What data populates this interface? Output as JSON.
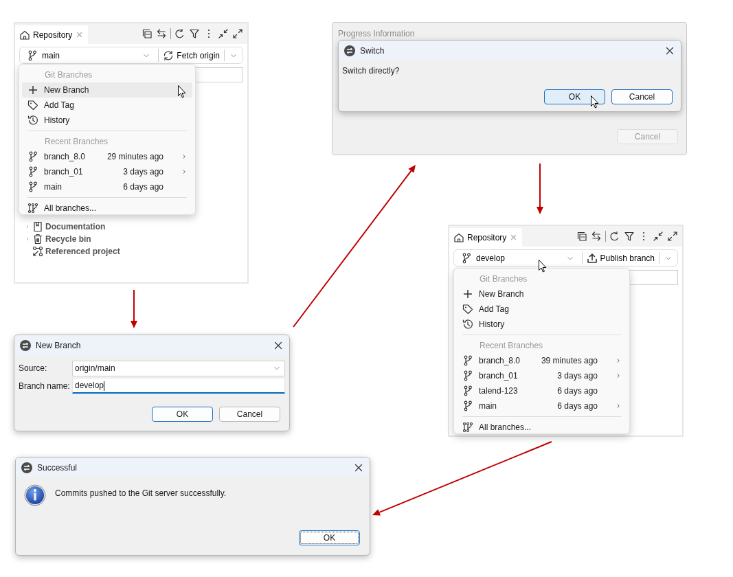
{
  "repository_panels": [
    {
      "tab": "Repository",
      "branch": "main",
      "action": {
        "kind": "fetch",
        "label": "Fetch origin"
      },
      "menu": {
        "heading": "Git Branches",
        "actions": [
          {
            "kind": "new",
            "label": "New Branch",
            "selected": true
          },
          {
            "kind": "tag",
            "label": "Add Tag",
            "selected": false
          },
          {
            "kind": "history",
            "label": "History",
            "selected": false
          }
        ],
        "recent_heading": "Recent Branches",
        "branches": [
          {
            "name": "branch_8.0",
            "time": "29 minutes ago",
            "submenu": true
          },
          {
            "name": "branch_01",
            "time": "3 days ago",
            "submenu": true
          },
          {
            "name": "main",
            "time": "6 days ago",
            "submenu": false
          }
        ],
        "all_label": "All branches..."
      },
      "tree": [
        {
          "kind": "documentation",
          "label": "Documentation",
          "expandable": true
        },
        {
          "kind": "recycle",
          "label": "Recycle bin",
          "expandable": true
        },
        {
          "kind": "referenced",
          "label": "Referenced project",
          "expandable": false
        }
      ]
    },
    {
      "tab": "Repository",
      "branch": "develop",
      "action": {
        "kind": "publish",
        "label": "Publish branch"
      },
      "menu": {
        "heading": "Git Branches",
        "actions": [
          {
            "kind": "new",
            "label": "New Branch",
            "selected": false
          },
          {
            "kind": "tag",
            "label": "Add Tag",
            "selected": false
          },
          {
            "kind": "history",
            "label": "History",
            "selected": false
          }
        ],
        "recent_heading": "Recent Branches",
        "branches": [
          {
            "name": "branch_8.0",
            "time": "39 minutes ago",
            "submenu": true
          },
          {
            "name": "branch_01",
            "time": "3 days ago",
            "submenu": true
          },
          {
            "name": "talend-123",
            "time": "6 days ago",
            "submenu": false
          },
          {
            "name": "main",
            "time": "6 days ago",
            "submenu": true
          }
        ],
        "all_label": "All branches..."
      }
    }
  ],
  "progress_window": {
    "title": "Progress Information",
    "buttons": [
      {
        "label": "Cancel",
        "disabled": true
      }
    ]
  },
  "switch_dialog": {
    "title": "Switch",
    "message": "Switch directly?",
    "buttons": [
      {
        "label": "OK",
        "default": true,
        "hovered": true
      },
      {
        "label": "Cancel",
        "default": true,
        "hovered": false
      }
    ]
  },
  "new_branch_dialog": {
    "title": "New Branch",
    "fields": [
      {
        "kind": "combo",
        "label": "Source:",
        "value": "origin/main",
        "focused": false
      },
      {
        "kind": "text",
        "label": "Branch name:",
        "value": "develop",
        "focused": true
      }
    ],
    "buttons": [
      {
        "label": "OK",
        "default": true
      },
      {
        "label": "Cancel",
        "default": false
      }
    ]
  },
  "success_dialog": {
    "title": "Successful",
    "message": "Commits pushed to the Git server successfully.",
    "buttons": [
      {
        "label": "OK",
        "default": true,
        "focused": true
      }
    ]
  }
}
